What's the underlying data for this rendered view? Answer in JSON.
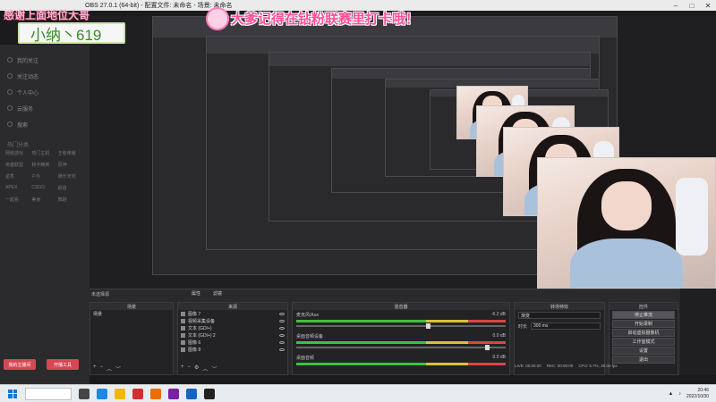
{
  "window": {
    "title": "OBS 27.0.1 (64-bit) - 配置文件: 未命名 - 场景: 未命名",
    "controls": [
      "–",
      "□",
      "✕"
    ]
  },
  "overlay": {
    "left_text": "感谢上面地位大哥",
    "banner": "大爹记得在钻粉联赛里打卡哦！",
    "name": "小纳丶619"
  },
  "sidebar": {
    "items": [
      {
        "label": "我的关注",
        "icon": "heart-icon"
      },
      {
        "label": "关注动态",
        "icon": "bell-icon"
      },
      {
        "label": "个人中心",
        "icon": "user-icon"
      },
      {
        "label": "云服务",
        "icon": "cloud-icon"
      },
      {
        "label": "搜索",
        "icon": "search-icon"
      }
    ],
    "section_title": "热门分类",
    "grid": [
      "网络游戏",
      "热门主机",
      "王者荣耀",
      "英雄联盟",
      "和平精英",
      "原神",
      "星秀",
      "户外",
      "娱乐天地",
      "APEX",
      "CSGO",
      "颜值",
      "一起看",
      "美食",
      "舞蹈"
    ],
    "buttons": [
      "我的主播间",
      "开播工具"
    ]
  },
  "dock": {
    "header": "未选择源",
    "tabs": [
      "属性",
      "滤镜"
    ],
    "scenes": {
      "title": "场景",
      "items": [
        "场景"
      ]
    },
    "sources": {
      "title": "来源",
      "items": [
        "图像 7",
        "视频采集设备",
        "文本 (GDI+)",
        "文本 (GDI+) 2",
        "图像 6",
        "图像 8"
      ]
    },
    "mixer": {
      "title": "混音器",
      "tracks": [
        {
          "name": "麦克风/Aux",
          "db": "-6.2 dB"
        },
        {
          "name": "桌面音频设备",
          "db": "0.0 dB"
        },
        {
          "name": "桌面音频",
          "db": "0.0 dB"
        }
      ]
    },
    "transitions": {
      "title": "转场特效",
      "type": "渐变",
      "duration_label": "时长",
      "duration": "300 ms"
    },
    "controls": {
      "title": "控件",
      "buttons": [
        "停止推流",
        "开始录制",
        "启动虚拟摄像机",
        "工作室模式",
        "设置",
        "退出"
      ]
    }
  },
  "status": {
    "live": "LIVE: 00:00:00",
    "rec": "REC: 00:00:00",
    "cpu": "CPU: 5.7%, 30.00 fps"
  },
  "taskbar": {
    "time": "20:46",
    "date": "2022/10/30"
  }
}
